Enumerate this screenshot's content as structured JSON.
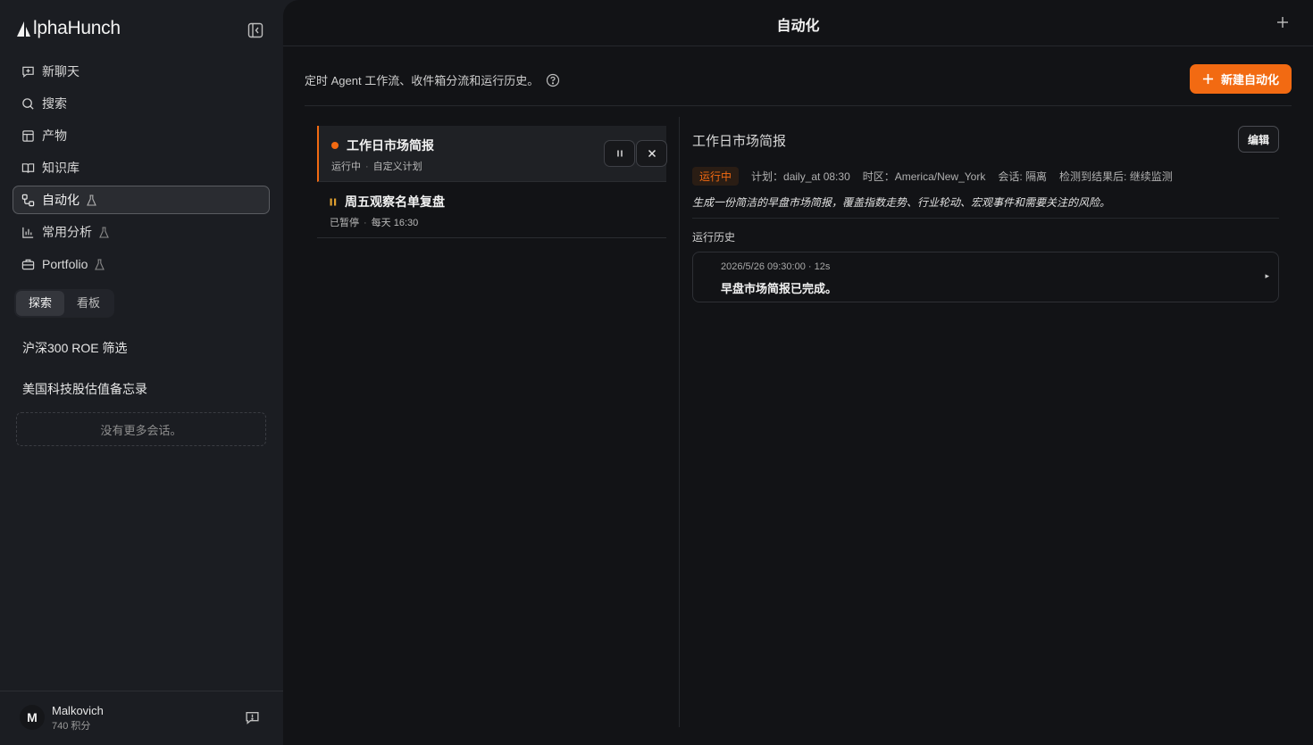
{
  "app": {
    "logo_text": "lphaHunch"
  },
  "sidebar": {
    "nav": [
      {
        "label": "新聊天",
        "icon": "new-chat-icon"
      },
      {
        "label": "搜索",
        "icon": "search-icon"
      },
      {
        "label": "产物",
        "icon": "layout-icon"
      },
      {
        "label": "知识库",
        "icon": "book-icon"
      },
      {
        "label": "自动化",
        "icon": "workflow-icon",
        "active": true,
        "experimental": true
      },
      {
        "label": "常用分析",
        "icon": "bar-chart-icon",
        "experimental": true
      },
      {
        "label": "Portfolio",
        "icon": "briefcase-icon",
        "experimental": true
      }
    ],
    "tabs": [
      "探索",
      "看板"
    ],
    "chats": [
      "沪深300 ROE 筛选",
      "美国科技股估值备忘录"
    ],
    "no_more": "没有更多会话。",
    "user": {
      "initial": "M",
      "name": "Malkovich",
      "points": "740 积分"
    }
  },
  "main": {
    "title": "自动化",
    "subtitle": "定时 Agent 工作流、收件箱分流和运行历史。",
    "new_button": "新建自动化",
    "list": [
      {
        "title": "工作日市场简报",
        "status": "运行中",
        "schedule": "自定义计划",
        "selected": true
      },
      {
        "title": "周五观察名单复盘",
        "status": "已暂停",
        "schedule": "每天 16:30",
        "selected": false
      }
    ],
    "detail": {
      "title": "工作日市场简报",
      "edit": "编辑",
      "status": "运行中",
      "plan": "计划：daily_at 08:30",
      "timezone": "时区：America/New_York",
      "session": "会话: 隔离",
      "on_detect": "检测到结果后: 继续监测",
      "description": "生成一份简洁的早盘市场简报，覆盖指数走势、行业轮动、宏观事件和需要关注的风险。",
      "history_label": "运行历史",
      "history": [
        {
          "time": "2026/5/26 09:30:00 · 12s",
          "message": "早盘市场简报已完成。"
        }
      ]
    }
  },
  "colors": {
    "accent": "#f26a12",
    "paused": "#e0a030"
  }
}
